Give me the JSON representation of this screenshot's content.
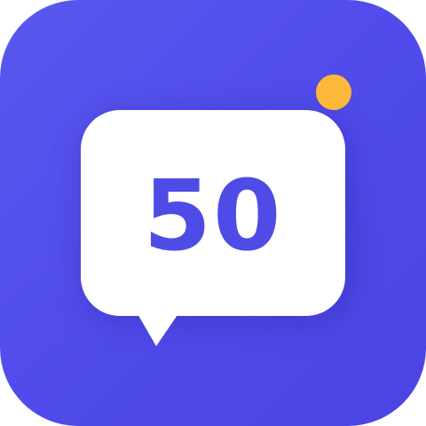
{
  "icon": {
    "number": "50",
    "background_color": "#534ee9",
    "bubble_color": "#ffffff",
    "number_color": "#4f4be6",
    "notification_dot_color": "#fdb83a",
    "glyphs": {
      "bubble": "speech-bubble-icon",
      "notification": "notification-dot"
    }
  }
}
